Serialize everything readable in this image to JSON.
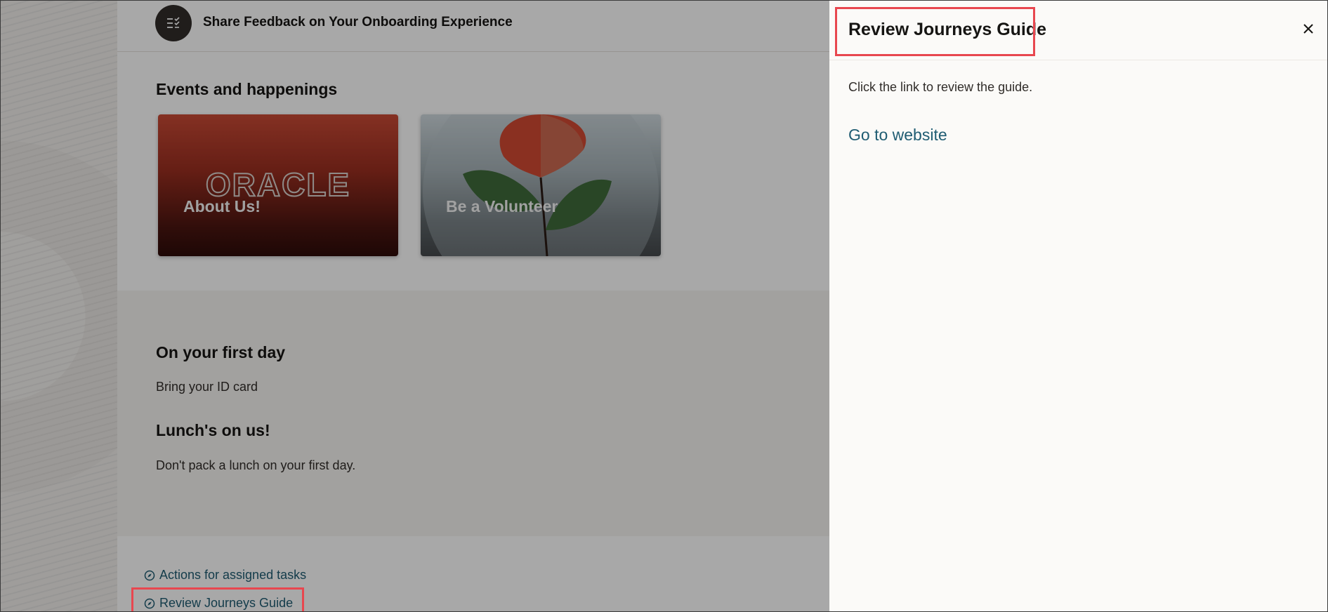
{
  "header": {
    "feedback_title": "Share Feedback on Your Onboarding Experience"
  },
  "events": {
    "title": "Events and happenings",
    "cards": [
      {
        "label": "About Us!",
        "logo_text": "ORACLE"
      },
      {
        "label": "Be a Volunteer"
      }
    ]
  },
  "info": {
    "first_day": {
      "heading": "On your first day",
      "text": "Bring your ID card"
    },
    "lunch": {
      "heading": "Lunch's on us!",
      "text": "Don't pack a lunch on your first day."
    }
  },
  "links": {
    "actions_label": "Actions for assigned tasks",
    "review_label": "Review Journeys Guide"
  },
  "drawer": {
    "title": "Review Journeys Guide",
    "description": "Click the link to review the guide.",
    "link_label": "Go to website"
  },
  "colors": {
    "link": "#1f5c72",
    "highlight": "#e8474f",
    "icon_bg": "#312d2a"
  },
  "icons": {
    "feedback": "checklist-icon",
    "task_link": "compass-icon",
    "close": "close-icon"
  }
}
